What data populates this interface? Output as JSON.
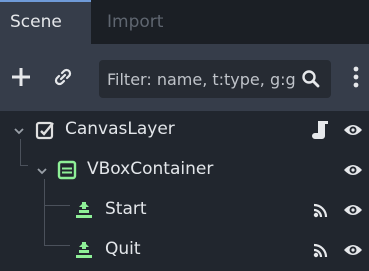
{
  "tabs": [
    {
      "label": "Scene",
      "active": true
    },
    {
      "label": "Import",
      "active": false
    }
  ],
  "toolbar": {
    "filter_placeholder": "Filter: name, t:type, g:group"
  },
  "tree": [
    {
      "name": "CanvasLayer",
      "icon": "canvas-layer-icon",
      "expanded": true,
      "extra_icon": "script-icon"
    },
    {
      "name": "VBoxContainer",
      "icon": "vbox-container-icon",
      "expanded": true
    },
    {
      "name": "Start",
      "icon": "button-node-icon",
      "extra_icon": "signal-icon"
    },
    {
      "name": "Quit",
      "icon": "button-node-icon",
      "extra_icon": "signal-icon"
    }
  ],
  "colors": {
    "accent": "#6f9ad8",
    "canvas_layer_icon": "#e0e0e0",
    "container_icon": "#8eef97",
    "button_node_icon": "#8eef97"
  }
}
